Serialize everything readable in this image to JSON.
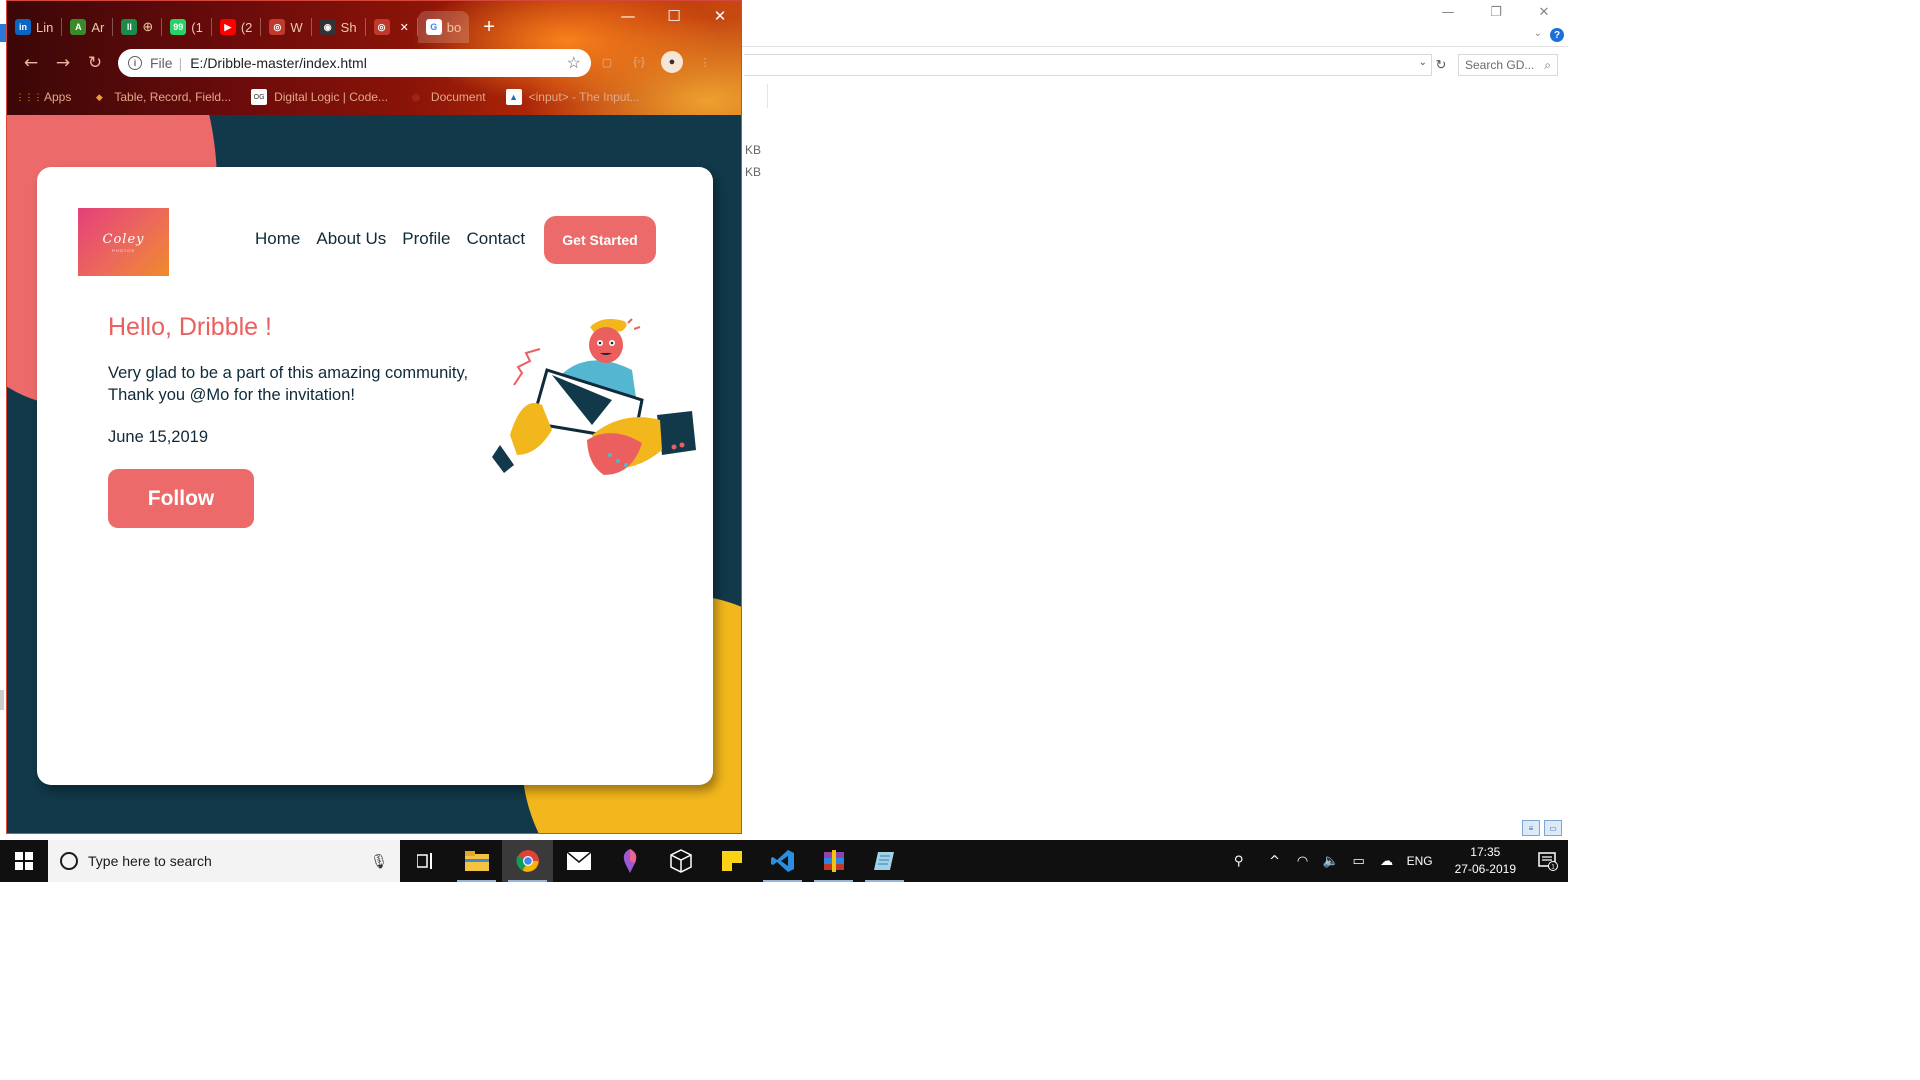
{
  "explorer": {
    "search_placeholder": "Search GD...",
    "sizes": [
      "KB",
      "KB"
    ],
    "controls": {
      "minimize": "—",
      "restore": "❐",
      "close": "✕"
    }
  },
  "chrome": {
    "tabs": [
      {
        "label": "Lin",
        "icon": "linkedin-icon",
        "color": "#0a66c2",
        "glyph": "in"
      },
      {
        "label": "Ar",
        "icon": "arena-icon",
        "color": "#3a8a2a",
        "glyph": "A"
      },
      {
        "label": "⊕",
        "icon": "chart-icon",
        "color": "#1c8a4a",
        "glyph": "ll"
      },
      {
        "label": "(1",
        "icon": "whatsapp-icon",
        "color": "#25d366",
        "glyph": "99"
      },
      {
        "label": "(2",
        "icon": "youtube-icon",
        "color": "#ff0000",
        "glyph": "▶"
      },
      {
        "label": "W",
        "icon": "globe-icon",
        "color": "#c0392b",
        "glyph": "◎"
      },
      {
        "label": "Sh",
        "icon": "github-icon",
        "color": "#333333",
        "glyph": "◉"
      },
      {
        "label": "",
        "icon": "globe-icon",
        "color": "#c0392b",
        "glyph": "◎",
        "closable": true
      },
      {
        "label": "bo",
        "icon": "google-icon",
        "color": "#ffffff",
        "glyph": "G",
        "active": true
      }
    ],
    "new_tab": "+",
    "window": {
      "minimize": "—",
      "maximize": "☐",
      "close": "✕"
    },
    "omnibox": {
      "scheme": "File",
      "url": "E:/Dribble-master/index.html"
    },
    "bookmarks": [
      {
        "label": "Apps",
        "icon": "apps-grid-icon"
      },
      {
        "label": "Table, Record, Field...",
        "icon": "folder-icon"
      },
      {
        "label": "Digital Logic | Code...",
        "icon": "og-icon"
      },
      {
        "label": "Document",
        "icon": "globe-icon"
      },
      {
        "label": "<input> - The Input...",
        "icon": "mdn-icon"
      }
    ]
  },
  "page": {
    "logo_text": "Coley",
    "logo_sub": "PHOTOS",
    "nav": [
      "Home",
      "About Us",
      "Profile",
      "Contact"
    ],
    "cta": "Get Started",
    "greeting": "Hello, Dribble !",
    "message": "Very glad to be a part of this amazing community, Thank you @Mo for the invitation!",
    "date": "June 15,2019",
    "follow": "Follow",
    "colors": {
      "accent": "#ec6a6a",
      "dark": "#11394a",
      "yellow": "#f2b71c"
    }
  },
  "taskbar": {
    "search_placeholder": "Type here to search",
    "lang": "ENG",
    "time": "17:35",
    "date": "27-06-2019",
    "notifications": "1"
  }
}
